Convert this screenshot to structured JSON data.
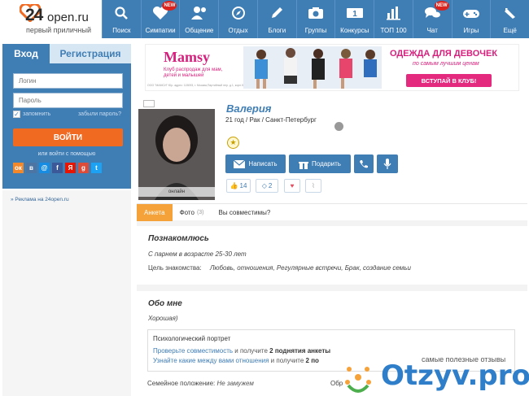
{
  "header": {
    "logo_number": "24",
    "logo_domain": "open.ru",
    "logo_tagline": "первый приличный",
    "nav": [
      {
        "label": "Поиск",
        "icon": "search-icon",
        "badge": ""
      },
      {
        "label": "Симпатии",
        "icon": "heart-icon",
        "badge": "NEW"
      },
      {
        "label": "Общение",
        "icon": "people-icon",
        "badge": ""
      },
      {
        "label": "Отдых",
        "icon": "compass-icon",
        "badge": ""
      },
      {
        "label": "Блоги",
        "icon": "pencil-icon",
        "badge": ""
      },
      {
        "label": "Группы",
        "icon": "camera-icon",
        "badge": ""
      },
      {
        "label": "Конкурсы",
        "icon": "number-one-icon",
        "badge": ""
      },
      {
        "label": "ТОП 100",
        "icon": "bar-chart-icon",
        "badge": ""
      },
      {
        "label": "Чат",
        "icon": "chat-icon",
        "badge": "NEW"
      },
      {
        "label": "Игры",
        "icon": "gamepad-icon",
        "badge": ""
      },
      {
        "label": "Ещё",
        "icon": "pencil-more-icon",
        "badge": ""
      }
    ]
  },
  "login": {
    "tab_login": "Вход",
    "tab_register": "Регистрация",
    "login_placeholder": "Логин",
    "password_placeholder": "Пароль",
    "remember_label": "запомнить",
    "forgot_label": "забыли пароль?",
    "submit_label": "ВОЙТИ",
    "or_text": "или войти с помощью",
    "socials": [
      "ок",
      "в",
      "@",
      "f",
      "Я",
      "g",
      "t"
    ]
  },
  "sidebar": {
    "ad_link": "» Реклама на 24open.ru"
  },
  "banner": {
    "brand": "Mamsy",
    "brand_sub": "Клуб распродаж для мам, детей и малышей",
    "legal": "ООО \"МАМСИ\" Юр. адрес: 115093, г. Москва,Партийный пер. д.1, корп.57,стр.3, ОГРН 5067746791 ИНН 7726582963",
    "title": "ОДЕЖДА ДЛЯ ДЕВОЧЕК",
    "subtitle": "по самым лучшим ценам",
    "cta": "ВСТУПАЙ В КЛУБ!"
  },
  "profile": {
    "name": "Валерия",
    "info": "21 год / Рак / Санкт-Петербург",
    "online": "онлайн",
    "star": "★",
    "write_btn": "Написать",
    "gift_btn": "Подарить",
    "likes": "14",
    "diamonds": "2"
  },
  "profile_tabs": {
    "anketa": "Анкета",
    "photos": "Фото",
    "photos_count": "(3)",
    "compatible": "Вы совместимы?"
  },
  "section_meet": {
    "title": "Познакомлюсь",
    "line1": "С парнем в возрасте 25-30 лет",
    "goal_label": "Цель знакомства:",
    "goal_value": "Любовь, отношения, Регулярные встречи, Брак, создание семьи"
  },
  "section_about": {
    "title": "Обо мне",
    "text": "Хорошая)",
    "psy_title": "Психологический портрет",
    "psy_link1": "Проверьте совместимость",
    "psy_mid1": " и получите ",
    "psy_bold1": "2 поднятия анкеты",
    "psy_link2": "Узнайте какие между вами отношения",
    "psy_mid2": " и получите ",
    "psy_bold2": "2 по",
    "family_label": "Семейное положение:",
    "family_value": "Не замужем",
    "col2_label": "Обр"
  },
  "watermark": {
    "tagline": "самые полезные отзывы",
    "brand": "Otzyv.pro"
  },
  "colors": {
    "accent": "#3f7db5",
    "orange": "#f06a22",
    "pink": "#d6207d"
  }
}
